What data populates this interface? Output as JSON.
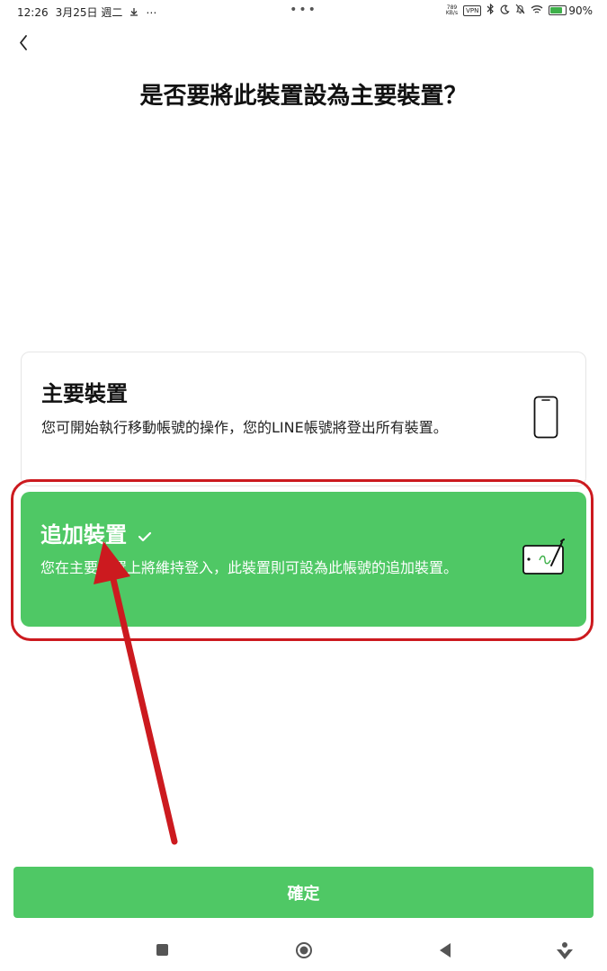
{
  "status_bar": {
    "time": "12:26",
    "date": "3月25日 週二",
    "extra": "⋯",
    "center": "•••",
    "net_speed_value": "789",
    "net_speed_unit": "KB/s",
    "vpn": "VPN",
    "battery_text": "90%",
    "battery_level": 0.9
  },
  "header": {
    "back_icon": "chevron-left-icon",
    "title": "是否要將此裝置設為主要裝置？"
  },
  "options": {
    "primary": {
      "title": "主要裝置",
      "description": "您可開始執行移動帳號的操作，您的LINE帳號將登出所有裝置。",
      "icon": "smartphone-icon",
      "selected": false
    },
    "secondary": {
      "title": "追加裝置",
      "description": "您在主要裝置上將維持登入，此裝置則可設為此帳號的追加裝置。",
      "icon": "tablet-pen-icon",
      "selected": true
    }
  },
  "colors": {
    "accent": "#4fc865",
    "annotation": "#cc1a1f"
  },
  "confirm_button": {
    "label": "確定"
  },
  "nav_bar": {
    "items": [
      "recent-apps-icon",
      "home-icon",
      "back-icon",
      "assistant-icon"
    ]
  }
}
